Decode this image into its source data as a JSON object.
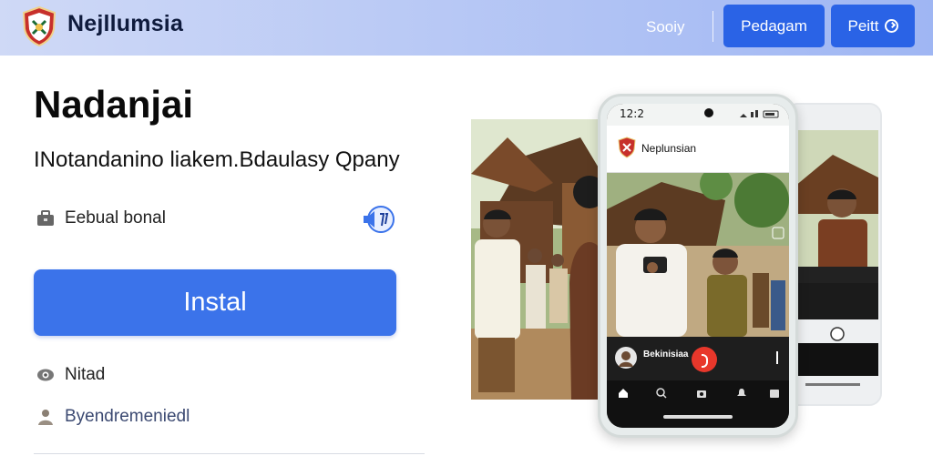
{
  "header": {
    "brand": "Nejllumsia",
    "nav_link": "Sooiy",
    "button_primary": "Pedagam",
    "button_secondary": "Peitt"
  },
  "hero": {
    "title": "Nadanjai",
    "subtitle": "INotandanino liakem.Bdaulasy Qpany"
  },
  "rows": {
    "feature": "Eebual bonal",
    "install_label": "Instal",
    "note": "Nitad",
    "user": "Byendremeniedl"
  },
  "phone": {
    "time": "12:2",
    "app_name": "Neplunsian",
    "profile": "Bekinisiaa"
  },
  "colors": {
    "accent": "#3b73ea",
    "header_button": "#2a63e6",
    "live": "#e8372b"
  },
  "icons": {
    "logo": "shield-emblem-icon",
    "feature": "briefcase-icon",
    "toggle": "speaker-icon",
    "note": "eye-icon",
    "user": "person-icon",
    "secondary_button": "arrow-circle-icon"
  }
}
